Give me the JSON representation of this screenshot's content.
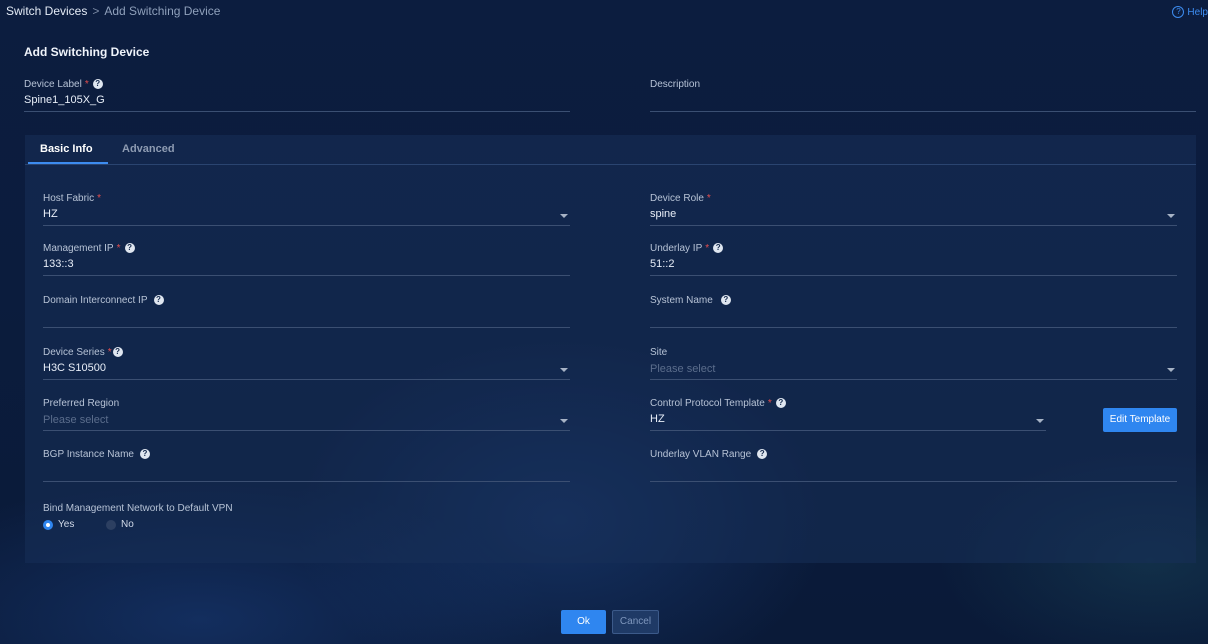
{
  "breadcrumb": {
    "root": "Switch Devices",
    "separator": ">",
    "current": "Add Switching Device"
  },
  "help": {
    "label": "Help",
    "icon": "question-circle-icon"
  },
  "page_title": "Add Switching Device",
  "header_fields": {
    "device_label": {
      "label": "Device Label",
      "required": "*",
      "value": "Spine1_105X_G"
    },
    "description": {
      "label": "Description",
      "value": ""
    }
  },
  "tabs": [
    {
      "label": "Basic Info",
      "active": true
    },
    {
      "label": "Advanced",
      "active": false
    }
  ],
  "form": {
    "host_fabric": {
      "label": "Host Fabric",
      "required": "*",
      "value": "HZ"
    },
    "device_role": {
      "label": "Device Role",
      "required": "*",
      "value": "spine"
    },
    "management_ip": {
      "label": "Management IP",
      "required": "*",
      "value": "133::3"
    },
    "underlay_ip": {
      "label": "Underlay IP",
      "required": "*",
      "value": "51::2"
    },
    "domain_interconnect_ip": {
      "label": "Domain Interconnect IP",
      "value": ""
    },
    "system_name": {
      "label": "System Name",
      "value": ""
    },
    "device_series": {
      "label": "Device Series",
      "required": "*",
      "value": "H3C S10500"
    },
    "site": {
      "label": "Site",
      "placeholder": "Please select"
    },
    "preferred_region": {
      "label": "Preferred Region",
      "placeholder": "Please select"
    },
    "control_protocol_template": {
      "label": "Control Protocol Template",
      "required": "*",
      "value": "HZ"
    },
    "edit_template_label": "Edit Template",
    "bgp_instance_name": {
      "label": "BGP Instance Name",
      "value": ""
    },
    "underlay_vlan_range": {
      "label": "Underlay VLAN Range",
      "value": ""
    },
    "bind_mgmt_network": {
      "label": "Bind Management Network to Default VPN",
      "options": [
        "Yes",
        "No"
      ],
      "selected": "Yes"
    }
  },
  "actions": {
    "ok_label": "Ok",
    "cancel_label": "Cancel"
  },
  "colors": {
    "accent": "#2f86f0",
    "required": "#e54d4d",
    "background": "#0b1c3d"
  }
}
